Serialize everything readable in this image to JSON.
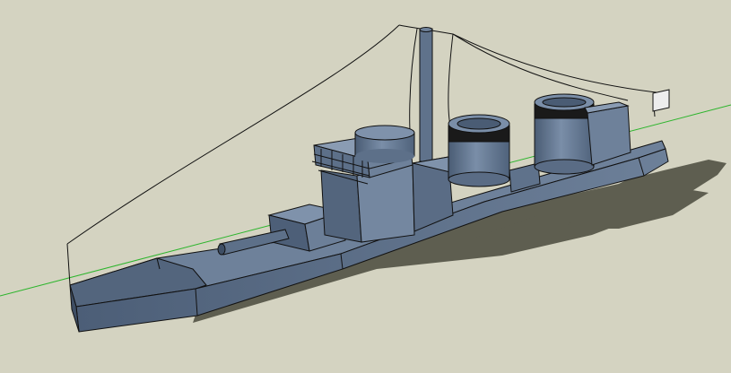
{
  "viewport": {
    "kind": "3d-modeling-canvas",
    "background_color": "#D4D3C1",
    "axis_color": "#2DB52D",
    "model": {
      "subject": "destroyer-warship",
      "hull_color": "#5B6E86",
      "hull_shade_color": "#3E4E64",
      "funnel_band_color": "#111111",
      "shadow_color": "#5E5E50",
      "edge_color": "#111111",
      "flag_color": "#EDEDED"
    }
  }
}
